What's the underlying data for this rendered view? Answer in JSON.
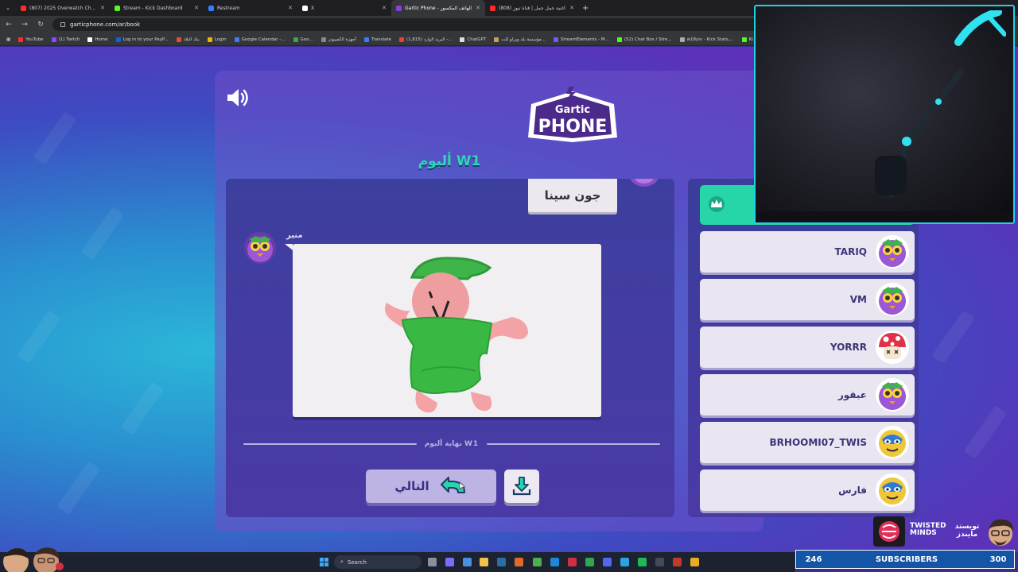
{
  "browser": {
    "tabs": [
      {
        "label": "(807) 2025 Overwatch Champi...",
        "color": "#ff2b2b",
        "active": false
      },
      {
        "label": "Stream - Kick Dashboard",
        "color": "#53fc18",
        "active": false
      },
      {
        "label": "Restream",
        "color": "#3c7bff",
        "active": false
      },
      {
        "label": "X",
        "color": "#ffffff",
        "active": false
      },
      {
        "label": "Gartic Phone - الهاتف المكسور",
        "color": "#8b3fd9",
        "active": true
      },
      {
        "label": "(808) أغنية جمل جمل | قناة تيوز",
        "color": "#ff2b2b",
        "active": false
      }
    ],
    "new_tab": "+",
    "url": "garticphone.com/ar/book",
    "bookmarks": [
      {
        "label": "YouTube",
        "color": "#ff2b2b"
      },
      {
        "label": "(1) Twitch",
        "color": "#9146ff"
      },
      {
        "label": "Home",
        "color": "#ffffff"
      },
      {
        "label": "Log in to your PayP...",
        "color": "#1a5fd0"
      },
      {
        "label": "بنك البلاد",
        "color": "#e0502a"
      },
      {
        "label": "Login",
        "color": "#f0b400"
      },
      {
        "label": "Google Calendar -...",
        "color": "#3c7bff"
      },
      {
        "label": "Goo...",
        "color": "#34a853"
      },
      {
        "label": "أجهزة الكمبيوتر",
        "color": "#888888"
      },
      {
        "label": "Translate",
        "color": "#3c7bff"
      },
      {
        "label": "البريد الوارد (1,815) -...",
        "color": "#ea4335"
      },
      {
        "label": "ChatGPT",
        "color": "#dddddd"
      },
      {
        "label": "مؤسسة بلد ويرلو للت...",
        "color": "#c0a060"
      },
      {
        "label": "StreamElements - M...",
        "color": "#6f5bff"
      },
      {
        "label": "(52) Chat Box / Stre...",
        "color": "#53fc18"
      },
      {
        "label": "w18yiv - Kick Stats,...",
        "color": "#aaaaaa"
      },
      {
        "label": "Ki",
        "color": "#53fc18"
      }
    ]
  },
  "game": {
    "logo_top": "Gartic",
    "logo_bottom": "PHONE",
    "album_title": "ألبوم W1",
    "previous_answer": "جون سينا",
    "drawer_name": "منير",
    "end_label": "نهاية ألبوم W1",
    "next_label": "التالي",
    "players": [
      {
        "name": "TARIQ",
        "avatar": "purple-owl"
      },
      {
        "name": "VM",
        "avatar": "purple-owl"
      },
      {
        "name": "YORRR",
        "avatar": "mushroom"
      },
      {
        "name": "عبقور",
        "avatar": "purple-owl"
      },
      {
        "name": "BRHOOMI07_TWIS",
        "avatar": "luchador"
      },
      {
        "name": "فارس",
        "avatar": "luchador"
      }
    ],
    "colors": {
      "accent": "#27d6a8",
      "title": "#2dd8b8",
      "button": "#bdb4e4"
    }
  },
  "overlay": {
    "sponsor_en": "TWISTED MINDS",
    "sponsor_ar": "تويستد مايندز",
    "subs_current": "246",
    "subs_label": "SUBSCRIBERS",
    "subs_goal": "300"
  },
  "taskbar": {
    "search_placeholder": "Search"
  }
}
